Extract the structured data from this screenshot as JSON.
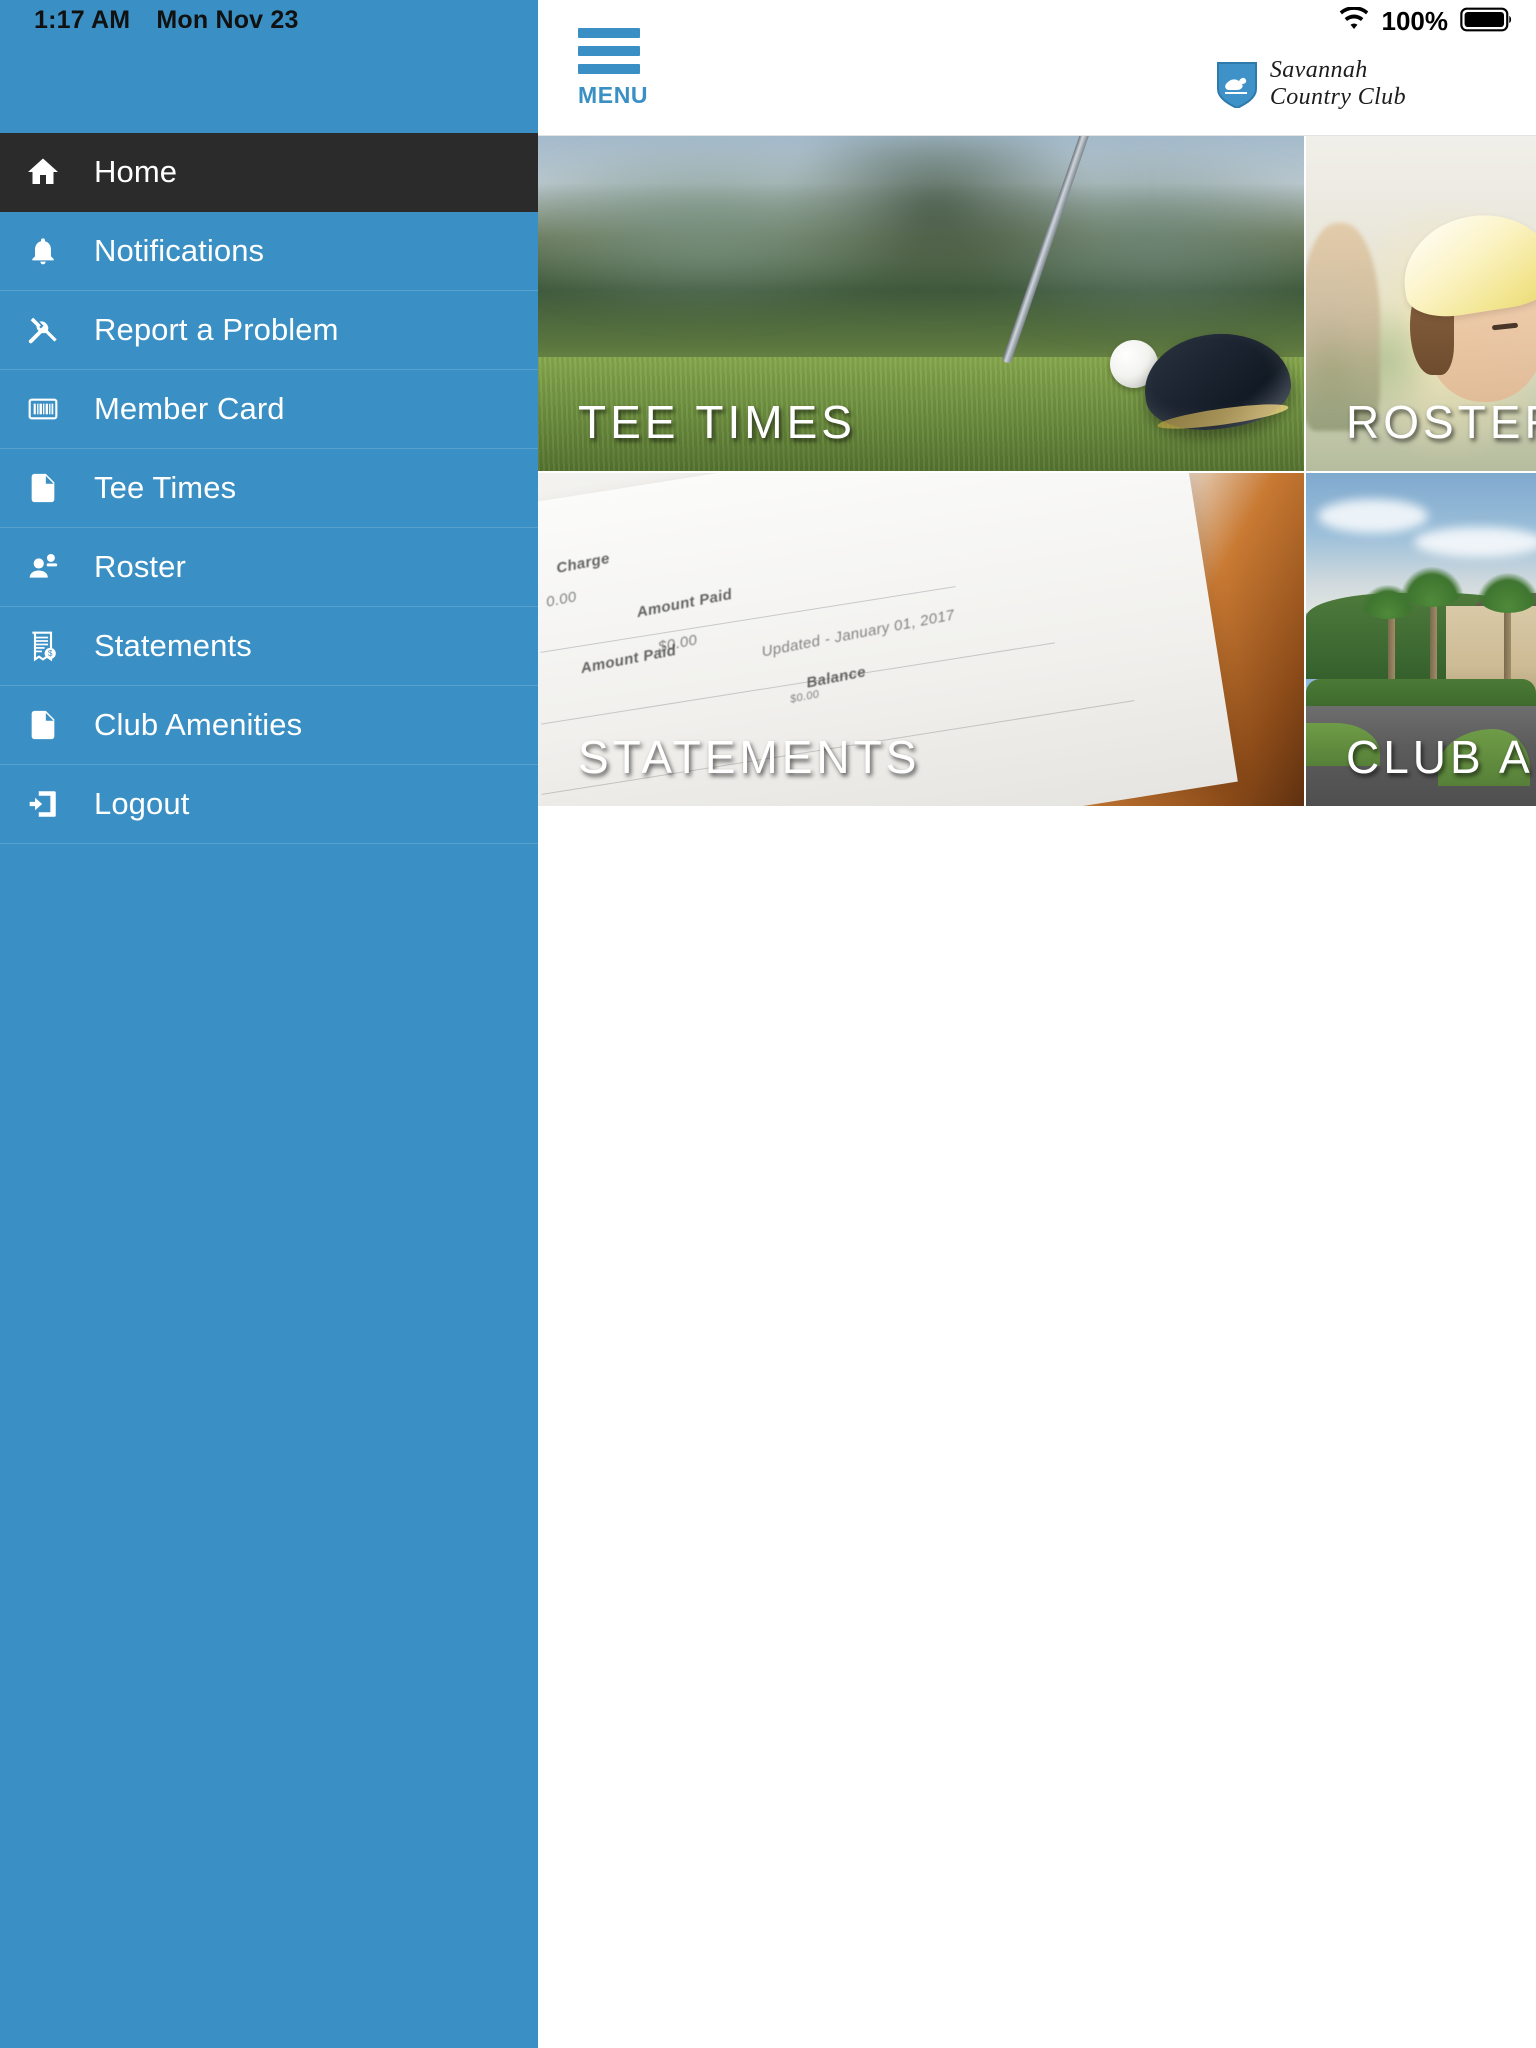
{
  "status_bar": {
    "time": "1:17 AM",
    "date": "Mon Nov 23",
    "wifi_icon": "wifi-icon",
    "battery_percent": "100%",
    "battery_icon": "battery-full-icon"
  },
  "colors": {
    "sidebar_blue": "#3a90c4",
    "active_item": "#2b2b2b",
    "accent": "#3a90c4",
    "tile_label": "#ffffff"
  },
  "sidebar": {
    "items": [
      {
        "label": "Home",
        "icon": "home-icon",
        "active": true
      },
      {
        "label": "Notifications",
        "icon": "bell-icon",
        "active": false
      },
      {
        "label": "Report a Problem",
        "icon": "tools-icon",
        "active": false
      },
      {
        "label": "Member Card",
        "icon": "barcode-icon",
        "active": false
      },
      {
        "label": "Tee Times",
        "icon": "document-icon",
        "active": false
      },
      {
        "label": "Roster",
        "icon": "person-add-icon",
        "active": false
      },
      {
        "label": "Statements",
        "icon": "receipt-icon",
        "active": false
      },
      {
        "label": "Club Amenities",
        "icon": "document-icon",
        "active": false
      },
      {
        "label": "Logout",
        "icon": "logout-icon",
        "active": false
      }
    ]
  },
  "topbar": {
    "menu_icon": "hamburger-icon",
    "menu_label": "MENU",
    "brand": {
      "shield_icon": "swan-shield-icon",
      "line1": "Savannah",
      "line2": "Country Club"
    }
  },
  "tiles": [
    {
      "label": "TEE TIMES",
      "image": "golf-club-and-ball-on-grass"
    },
    {
      "label": "ROSTER",
      "image": "woman-in-yellow-cap-outdoors"
    },
    {
      "label": "STATEMENTS",
      "image": "printed-billing-statement"
    },
    {
      "label": "CLUB AMENITIES",
      "image": "club-entrance-with-palm-trees"
    }
  ],
  "statement_image_text": {
    "charge": "Charge",
    "amount_00": "0.00",
    "amount_paid_1": "Amount Paid",
    "amount_paid_2": "Amount Paid",
    "amount_zero": "$0.00",
    "updated": "Updated - January 01, 2017",
    "balance": "Balance",
    "small": "$0.00"
  }
}
